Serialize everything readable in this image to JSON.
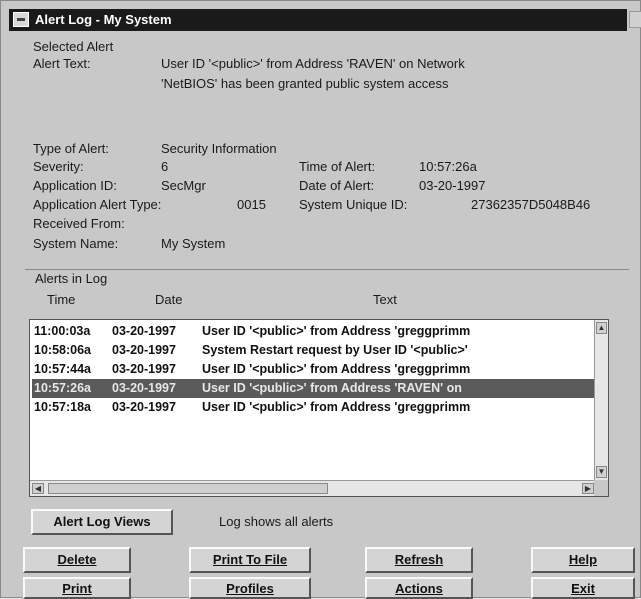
{
  "window": {
    "title": "Alert Log - My System"
  },
  "selected_alert": {
    "group_label": "Selected Alert",
    "alert_text_label": "Alert Text:",
    "alert_text_line1": "User ID '<public>' from Address 'RAVEN' on Network",
    "alert_text_line2": "'NetBIOS' has been granted public system access",
    "type_label": "Type of Alert:",
    "type_value": "Security Information",
    "severity_label": "Severity:",
    "severity_value": "6",
    "app_id_label": "Application ID:",
    "app_id_value": "SecMgr",
    "app_alert_type_label": "Application Alert Type:",
    "app_alert_type_value": "0015",
    "received_from_label": "Received From:",
    "received_from_value": "",
    "system_name_label": "System Name:",
    "system_name_value": "My System",
    "time_label": "Time of Alert:",
    "time_value": "10:57:26a",
    "date_label": "Date of Alert:",
    "date_value": "03-20-1997",
    "unique_label": "System Unique ID:",
    "unique_value": "27362357D5048B46"
  },
  "alerts_log": {
    "group_label": "Alerts in Log",
    "col_time": "Time",
    "col_date": "Date",
    "col_text": "Text",
    "rows": [
      {
        "time": "11:00:03a",
        "date": "03-20-1997",
        "text": "User ID '<public>' from Address 'greggprimm"
      },
      {
        "time": "10:58:06a",
        "date": "03-20-1997",
        "text": "System Restart request by User ID '<public>'"
      },
      {
        "time": "10:57:44a",
        "date": "03-20-1997",
        "text": "User ID '<public>' from Address 'greggprimm"
      },
      {
        "time": "10:57:26a",
        "date": "03-20-1997",
        "text": "User ID '<public>' from Address 'RAVEN' on"
      },
      {
        "time": "10:57:18a",
        "date": "03-20-1997",
        "text": "User ID '<public>' from Address 'greggprimm"
      }
    ],
    "selected_index": 3
  },
  "views": {
    "button_label": "Alert Log Views",
    "status_text": "Log shows all alerts"
  },
  "buttons": {
    "delete": "Delete",
    "print_to_file": "Print To File",
    "refresh": "Refresh",
    "help": "Help",
    "print": "Print",
    "profiles": "Profiles",
    "actions": "Actions",
    "exit": "Exit"
  },
  "colors": {
    "titlebar": "#1a1a1a",
    "window_bg": "#c8c8c8",
    "selected_row": "#5a5a5a"
  },
  "icons": [
    "system-menu-icon",
    "maximize-icon",
    "scroll-up-icon",
    "scroll-down-icon",
    "scroll-left-icon",
    "scroll-right-icon"
  ]
}
